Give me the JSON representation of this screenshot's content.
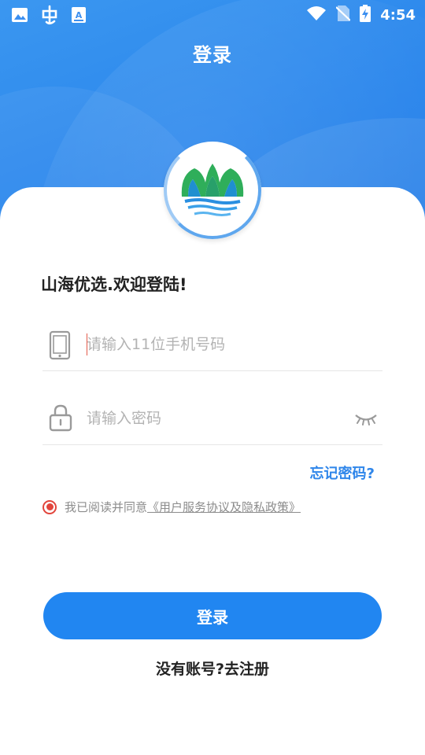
{
  "status_bar": {
    "time": "4:54",
    "icons": [
      "image-icon",
      "bug-app-icon",
      "text-a-icon",
      "wifi-icon",
      "no-sim-icon",
      "battery-charging-icon"
    ]
  },
  "header": {
    "title": "登录"
  },
  "welcome": "山海优选.欢迎登陆!",
  "phone_field": {
    "placeholder": "请输入11位手机号码",
    "value": "",
    "icon": "phone-icon"
  },
  "password_field": {
    "placeholder": "请输入密码",
    "value": "",
    "icon": "lock-icon",
    "toggle_icon": "eye-closed-icon"
  },
  "forgot_password": "忘记密码?",
  "agreement": {
    "checked": true,
    "prefix": "我已阅读并同意",
    "link": "《用户服务协议及隐私政策》"
  },
  "login_button": "登录",
  "register_link": "没有账号?去注册",
  "colors": {
    "primary": "#2186f1",
    "link": "#2f86ea",
    "radio": "#e2453c"
  }
}
